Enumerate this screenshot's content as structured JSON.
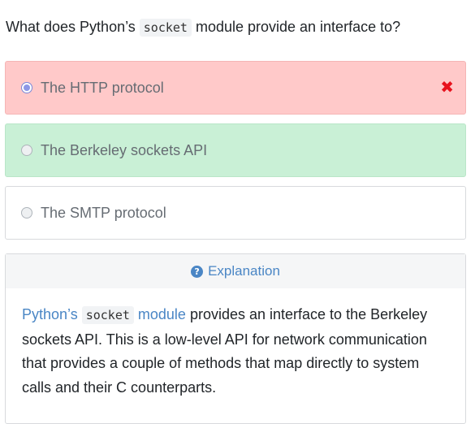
{
  "question": {
    "prefix": "What does Python’s ",
    "code": "socket",
    "suffix": " module provide an interface to?"
  },
  "options": [
    {
      "label": "The HTTP protocol",
      "state": "selected-wrong"
    },
    {
      "label": "The Berkeley sockets API",
      "state": "correct"
    },
    {
      "label": "The SMTP protocol",
      "state": "neutral"
    }
  ],
  "wrong_mark": "✖",
  "explanation": {
    "title": "Explanation",
    "link_prefix": "Python’s ",
    "link_code": "socket",
    "link_suffix": " module",
    "text": " provides an interface to the Berkeley sockets API. This is a low-level API for network communication that provides a couple of methods that map directly to system calls and their C counterparts."
  },
  "colors": {
    "wrong_bg": "#ffc9c9",
    "correct_bg": "#c9f0d6",
    "link": "#4a86c5",
    "x_mark": "#e8121d"
  }
}
